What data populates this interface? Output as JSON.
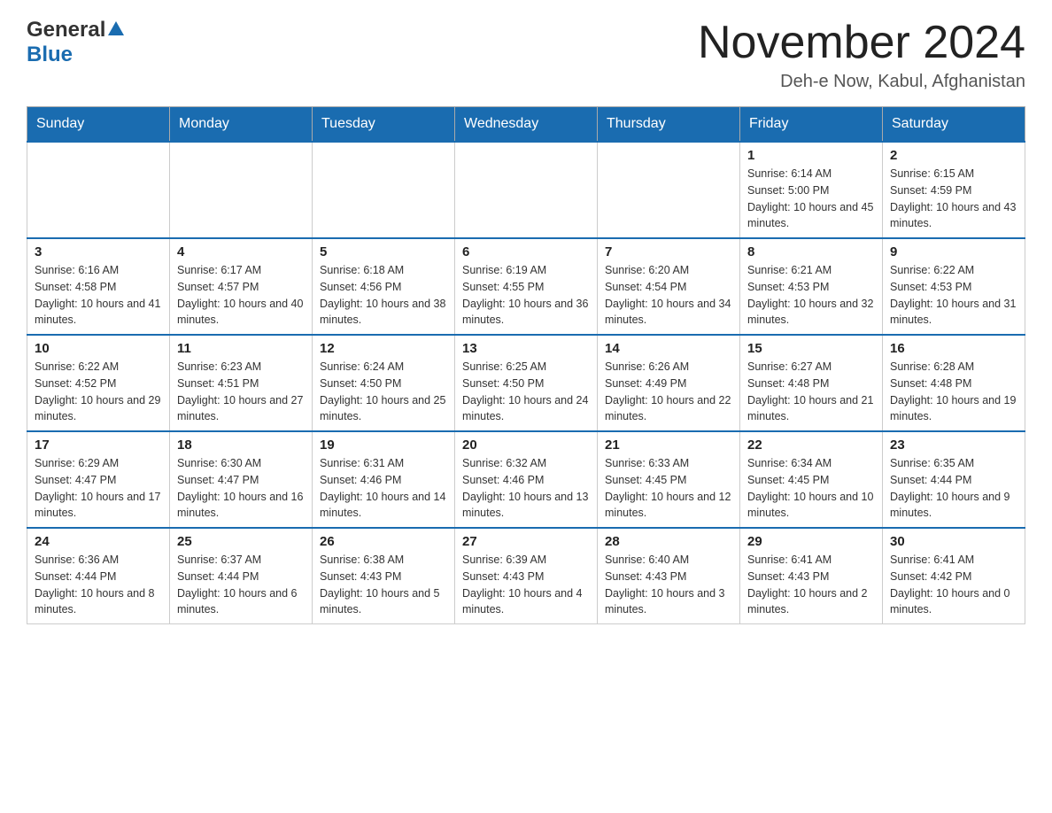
{
  "header": {
    "logo": {
      "general": "General",
      "blue": "Blue"
    },
    "title": "November 2024",
    "location": "Deh-e Now, Kabul, Afghanistan"
  },
  "calendar": {
    "days_of_week": [
      "Sunday",
      "Monday",
      "Tuesday",
      "Wednesday",
      "Thursday",
      "Friday",
      "Saturday"
    ],
    "weeks": [
      {
        "days": [
          {
            "date": "",
            "info": ""
          },
          {
            "date": "",
            "info": ""
          },
          {
            "date": "",
            "info": ""
          },
          {
            "date": "",
            "info": ""
          },
          {
            "date": "",
            "info": ""
          },
          {
            "date": "1",
            "info": "Sunrise: 6:14 AM\nSunset: 5:00 PM\nDaylight: 10 hours and 45 minutes."
          },
          {
            "date": "2",
            "info": "Sunrise: 6:15 AM\nSunset: 4:59 PM\nDaylight: 10 hours and 43 minutes."
          }
        ]
      },
      {
        "days": [
          {
            "date": "3",
            "info": "Sunrise: 6:16 AM\nSunset: 4:58 PM\nDaylight: 10 hours and 41 minutes."
          },
          {
            "date": "4",
            "info": "Sunrise: 6:17 AM\nSunset: 4:57 PM\nDaylight: 10 hours and 40 minutes."
          },
          {
            "date": "5",
            "info": "Sunrise: 6:18 AM\nSunset: 4:56 PM\nDaylight: 10 hours and 38 minutes."
          },
          {
            "date": "6",
            "info": "Sunrise: 6:19 AM\nSunset: 4:55 PM\nDaylight: 10 hours and 36 minutes."
          },
          {
            "date": "7",
            "info": "Sunrise: 6:20 AM\nSunset: 4:54 PM\nDaylight: 10 hours and 34 minutes."
          },
          {
            "date": "8",
            "info": "Sunrise: 6:21 AM\nSunset: 4:53 PM\nDaylight: 10 hours and 32 minutes."
          },
          {
            "date": "9",
            "info": "Sunrise: 6:22 AM\nSunset: 4:53 PM\nDaylight: 10 hours and 31 minutes."
          }
        ]
      },
      {
        "days": [
          {
            "date": "10",
            "info": "Sunrise: 6:22 AM\nSunset: 4:52 PM\nDaylight: 10 hours and 29 minutes."
          },
          {
            "date": "11",
            "info": "Sunrise: 6:23 AM\nSunset: 4:51 PM\nDaylight: 10 hours and 27 minutes."
          },
          {
            "date": "12",
            "info": "Sunrise: 6:24 AM\nSunset: 4:50 PM\nDaylight: 10 hours and 25 minutes."
          },
          {
            "date": "13",
            "info": "Sunrise: 6:25 AM\nSunset: 4:50 PM\nDaylight: 10 hours and 24 minutes."
          },
          {
            "date": "14",
            "info": "Sunrise: 6:26 AM\nSunset: 4:49 PM\nDaylight: 10 hours and 22 minutes."
          },
          {
            "date": "15",
            "info": "Sunrise: 6:27 AM\nSunset: 4:48 PM\nDaylight: 10 hours and 21 minutes."
          },
          {
            "date": "16",
            "info": "Sunrise: 6:28 AM\nSunset: 4:48 PM\nDaylight: 10 hours and 19 minutes."
          }
        ]
      },
      {
        "days": [
          {
            "date": "17",
            "info": "Sunrise: 6:29 AM\nSunset: 4:47 PM\nDaylight: 10 hours and 17 minutes."
          },
          {
            "date": "18",
            "info": "Sunrise: 6:30 AM\nSunset: 4:47 PM\nDaylight: 10 hours and 16 minutes."
          },
          {
            "date": "19",
            "info": "Sunrise: 6:31 AM\nSunset: 4:46 PM\nDaylight: 10 hours and 14 minutes."
          },
          {
            "date": "20",
            "info": "Sunrise: 6:32 AM\nSunset: 4:46 PM\nDaylight: 10 hours and 13 minutes."
          },
          {
            "date": "21",
            "info": "Sunrise: 6:33 AM\nSunset: 4:45 PM\nDaylight: 10 hours and 12 minutes."
          },
          {
            "date": "22",
            "info": "Sunrise: 6:34 AM\nSunset: 4:45 PM\nDaylight: 10 hours and 10 minutes."
          },
          {
            "date": "23",
            "info": "Sunrise: 6:35 AM\nSunset: 4:44 PM\nDaylight: 10 hours and 9 minutes."
          }
        ]
      },
      {
        "days": [
          {
            "date": "24",
            "info": "Sunrise: 6:36 AM\nSunset: 4:44 PM\nDaylight: 10 hours and 8 minutes."
          },
          {
            "date": "25",
            "info": "Sunrise: 6:37 AM\nSunset: 4:44 PM\nDaylight: 10 hours and 6 minutes."
          },
          {
            "date": "26",
            "info": "Sunrise: 6:38 AM\nSunset: 4:43 PM\nDaylight: 10 hours and 5 minutes."
          },
          {
            "date": "27",
            "info": "Sunrise: 6:39 AM\nSunset: 4:43 PM\nDaylight: 10 hours and 4 minutes."
          },
          {
            "date": "28",
            "info": "Sunrise: 6:40 AM\nSunset: 4:43 PM\nDaylight: 10 hours and 3 minutes."
          },
          {
            "date": "29",
            "info": "Sunrise: 6:41 AM\nSunset: 4:43 PM\nDaylight: 10 hours and 2 minutes."
          },
          {
            "date": "30",
            "info": "Sunrise: 6:41 AM\nSunset: 4:42 PM\nDaylight: 10 hours and 0 minutes."
          }
        ]
      }
    ]
  }
}
